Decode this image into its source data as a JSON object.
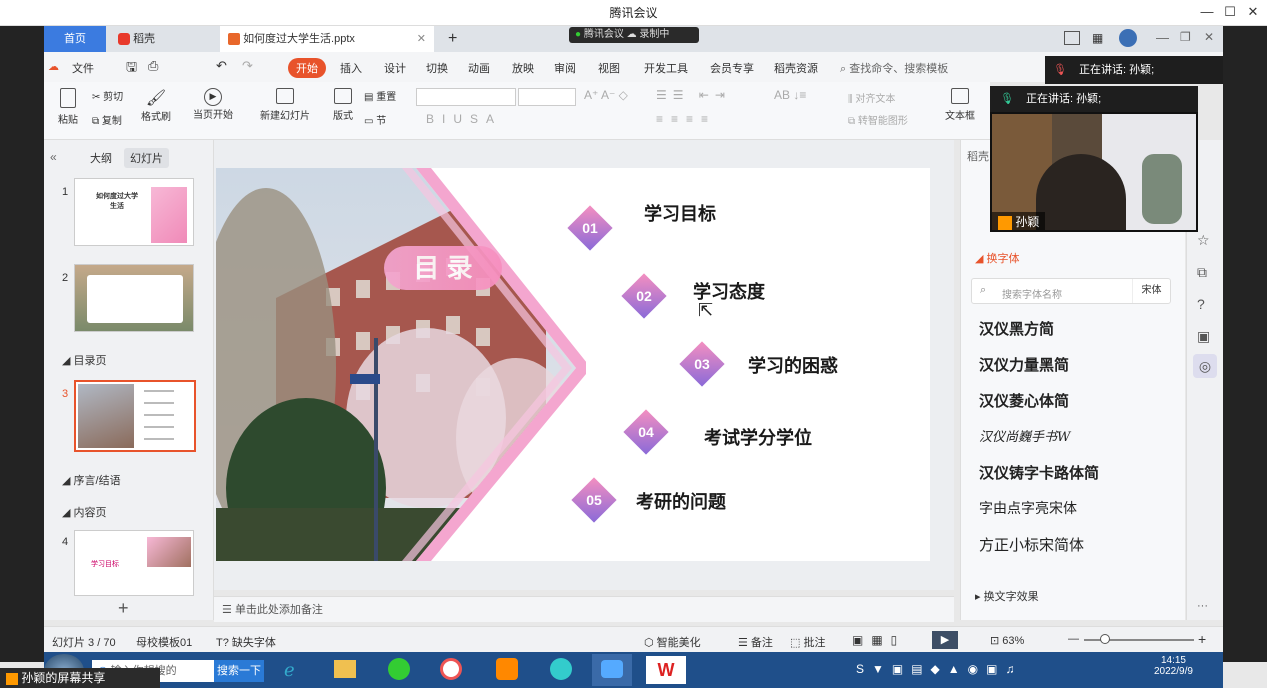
{
  "meeting": {
    "title": "腾讯会议",
    "status_recording": "录制中",
    "status_meeting": "腾讯会议",
    "speaking_top": "正在讲话: 孙颖;",
    "speaking_video": "正在讲话: 孙颖;",
    "video_name": "孙颖",
    "share_label": "孙颖的屏幕共享"
  },
  "tabs": {
    "home": "首页",
    "daoke": "稻壳",
    "file": "如何度过大学生活.pptx",
    "add": "+"
  },
  "menu": {
    "file": "文件",
    "start": "开始",
    "insert": "插入",
    "design": "设计",
    "switch": "切换",
    "animation": "动画",
    "show": "放映",
    "review": "审阅",
    "view": "视图",
    "dev": "开发工具",
    "member": "会员专享",
    "resource": "稻壳资源",
    "search": "查找命令、搜索模板"
  },
  "ribbon": {
    "paste": "粘贴",
    "cut": "剪切",
    "copy": "复制",
    "format": "格式刷",
    "play": "当页开始",
    "new_slide": "新建幻灯片",
    "layout": "版式",
    "reset": "重置",
    "section": "节",
    "align": "对齐文本",
    "smart": "转智能图形",
    "textbox": "文本框"
  },
  "sidebar": {
    "outline": "大纲",
    "slides": "幻灯片",
    "sec_catalog": "目录页",
    "sec_preface": "序言/结语",
    "sec_content": "内容页",
    "thumb1_title": "如何度过大学生活",
    "thumb4_title": "学习目标",
    "nums": [
      "1",
      "2",
      "3",
      "4"
    ]
  },
  "slide": {
    "title": "目 录",
    "items": [
      {
        "num": "01",
        "text": "学习目标"
      },
      {
        "num": "02",
        "text": "学习态度"
      },
      {
        "num": "03",
        "text": "学习的困惑"
      },
      {
        "num": "04",
        "text": "考试学分学位"
      },
      {
        "num": "05",
        "text": "考研的问题"
      }
    ]
  },
  "notes": "单击此处添加备注",
  "rpanel": {
    "header": "稻壳",
    "section_font": "换字体",
    "search_placeholder": "搜索字体名称",
    "current_font": "宋体",
    "fonts": [
      "汉仪黑方简",
      "汉仪力量黑简",
      "汉仪菱心体简",
      "汉仪尚巍手书W",
      "汉仪铸字卡路体简",
      "字由点字亮宋体",
      "方正小标宋简体"
    ],
    "effects": "换文字效果"
  },
  "status": {
    "slide": "幻灯片 3 / 70",
    "master": "母校模板01",
    "missing_font": "缺失字体",
    "beautify": "智能美化",
    "notes": "备注",
    "comment": "批注",
    "zoom": "63%"
  },
  "taskbar": {
    "search_placeholder": "输入你想搜的",
    "search_button": "搜索一下",
    "time": "14:15",
    "date": "2022/9/9"
  }
}
